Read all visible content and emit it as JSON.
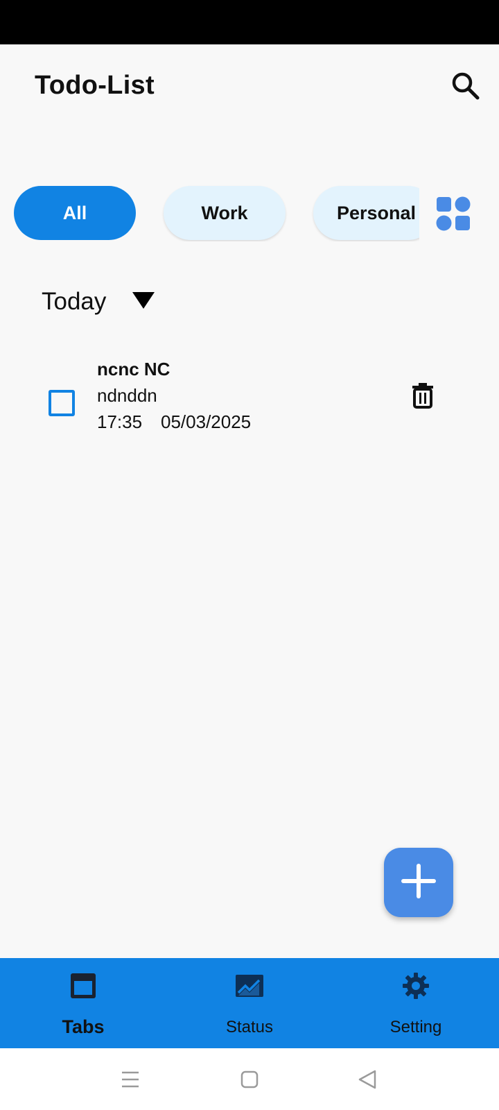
{
  "app": {
    "title": "Todo-List"
  },
  "filters": {
    "chips": [
      "All",
      "Work",
      "Personal"
    ],
    "active": "All"
  },
  "section": {
    "label": "Today"
  },
  "tasks": [
    {
      "title": "ncnc NC",
      "description": "ndnddn",
      "time": "17:35",
      "date": "05/03/2025",
      "checked": false
    }
  ],
  "bottom_nav": {
    "items": [
      {
        "label": "Tabs",
        "icon": "tabs-icon",
        "active": true
      },
      {
        "label": "Status",
        "icon": "chart-icon",
        "active": false
      },
      {
        "label": "Setting",
        "icon": "gear-icon",
        "active": false
      }
    ]
  },
  "colors": {
    "primary": "#1183E3",
    "chip_inactive": "#E3F3FD",
    "fab": "#4A8BE5",
    "background": "#F8F8F8"
  },
  "icons": {
    "search": "search-icon",
    "grid": "grid-icon",
    "caret": "caret-down-icon",
    "delete": "trash-icon",
    "add": "plus-icon",
    "system_nav": [
      "menu-icon",
      "home-icon",
      "back-icon"
    ]
  }
}
